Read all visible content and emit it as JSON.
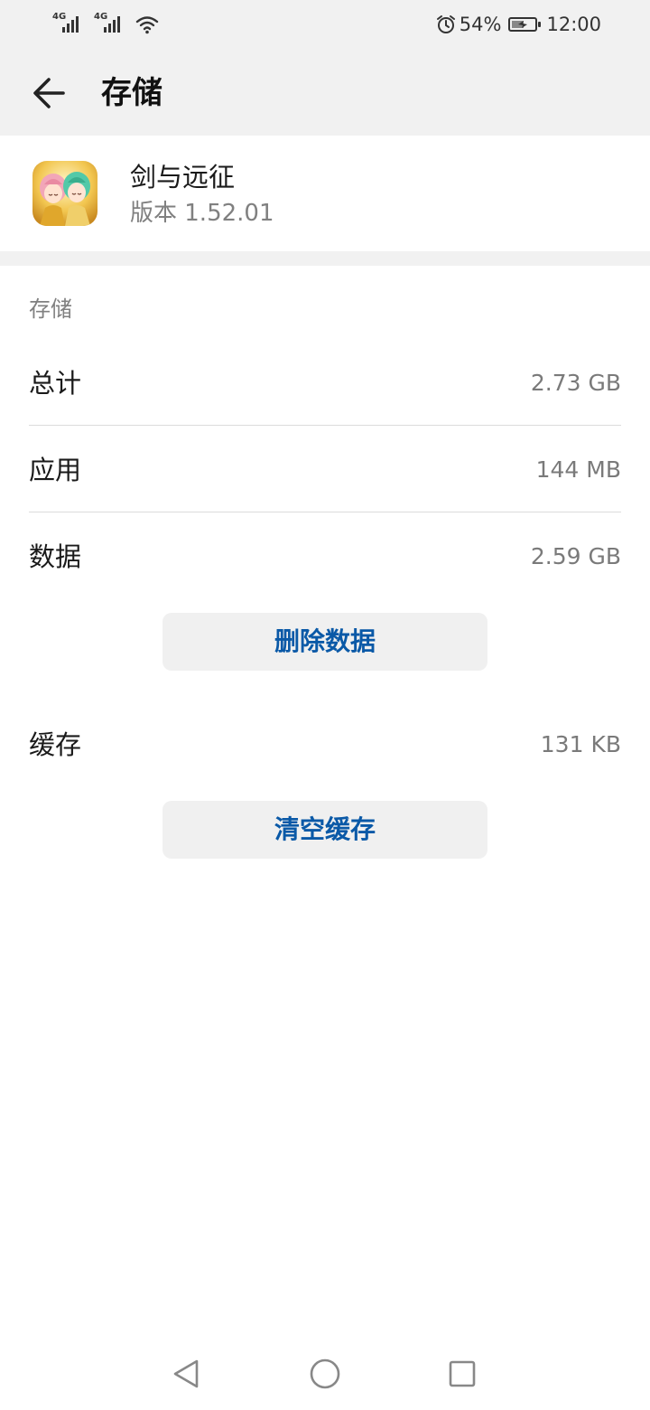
{
  "status_bar": {
    "network_1": "4G",
    "network_2": "4G",
    "battery_percent": "54%",
    "battery_level": 0.54,
    "time": "12:00",
    "icons": [
      "signal-icon",
      "wifi-icon",
      "alarm-icon",
      "battery-charging-icon"
    ]
  },
  "header": {
    "title": "存储",
    "back_icon": "back-arrow-icon"
  },
  "app": {
    "name": "剑与远征",
    "version": "版本 1.52.01"
  },
  "storage": {
    "section_label": "存储",
    "rows": [
      {
        "label": "总计",
        "value": "2.73 GB"
      },
      {
        "label": "应用",
        "value": "144 MB"
      },
      {
        "label": "数据",
        "value": "2.59 GB"
      },
      {
        "label": "缓存",
        "value": "131 KB"
      }
    ],
    "delete_data_label": "删除数据",
    "clear_cache_label": "清空缓存"
  },
  "nav": {
    "icons": [
      "back-triangle-icon",
      "home-circle-icon",
      "recents-square-icon"
    ]
  },
  "colors": {
    "accent": "#0a59a7",
    "header_bg": "#f1f1f1",
    "secondary_text": "#808080",
    "button_bg": "#f0f0f0"
  }
}
